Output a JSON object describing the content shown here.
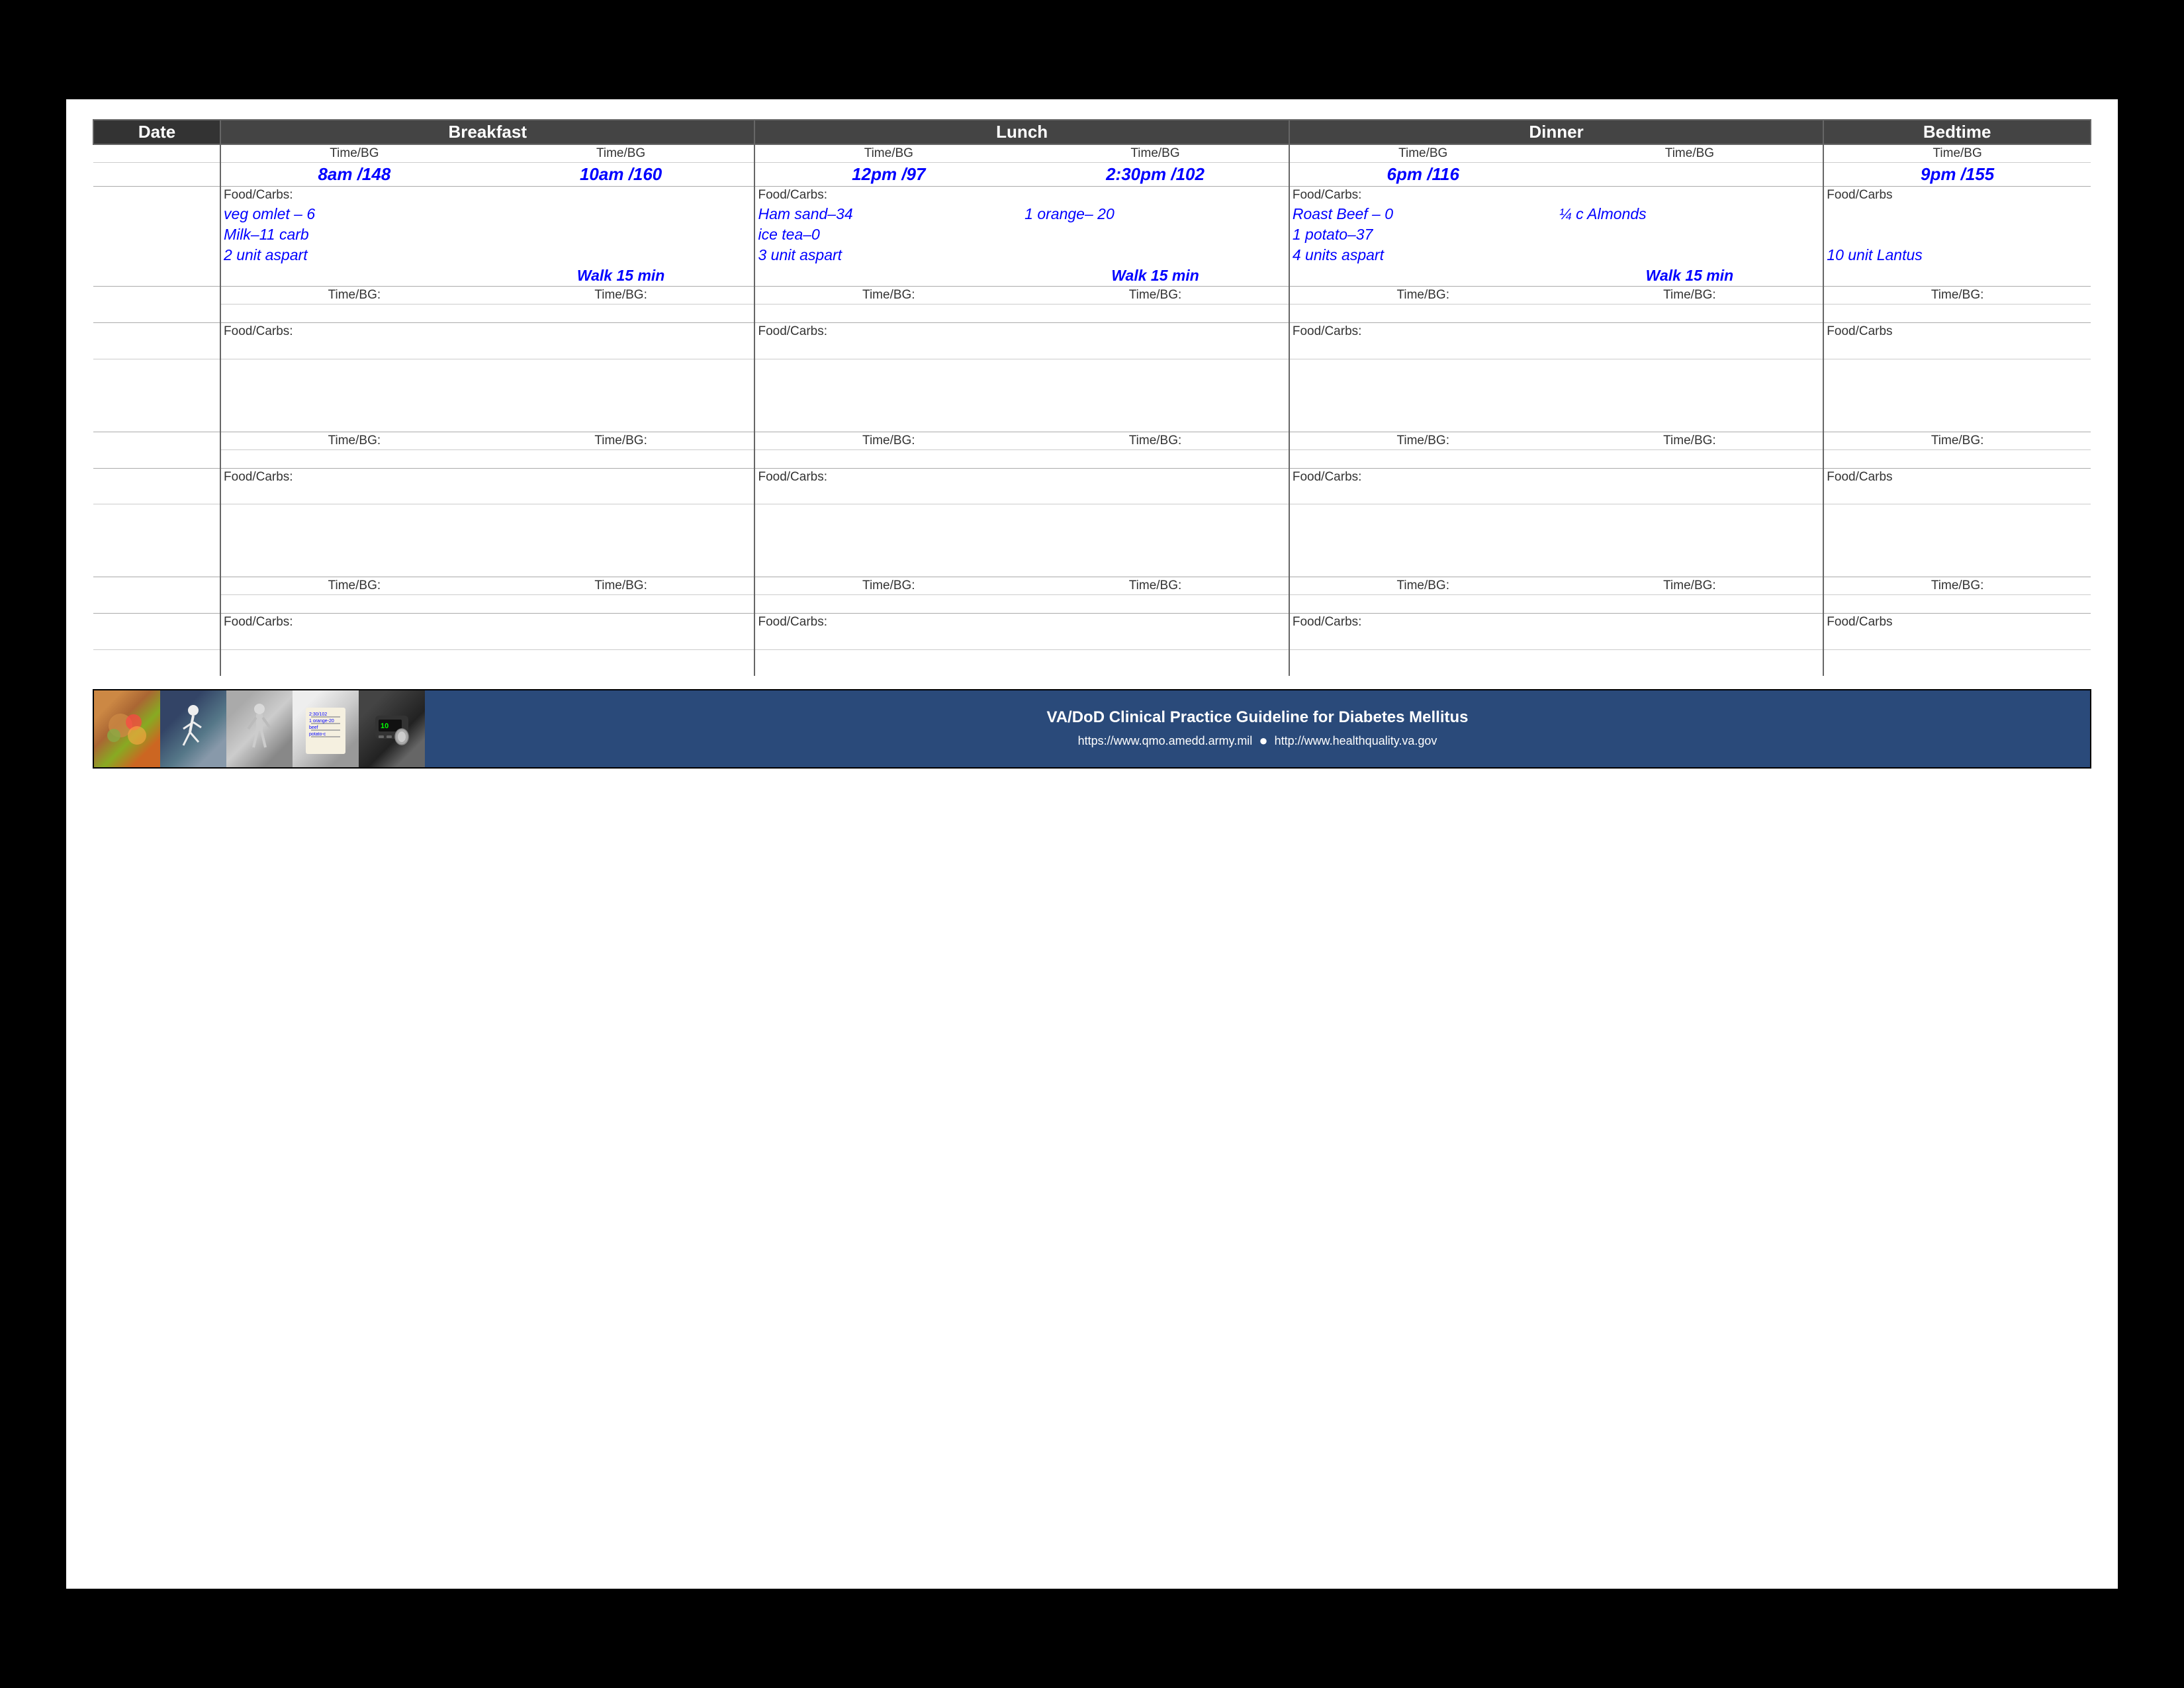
{
  "header": {
    "date_col": "Date",
    "breakfast_col": "Breakfast",
    "lunch_col": "Lunch",
    "dinner_col": "Dinner",
    "bedtime_col": "Bedtime"
  },
  "subheader": {
    "timebg": "Time/BG"
  },
  "row1": {
    "b1_time": "8am /148",
    "b2_time": "10am /160",
    "l1_time": "12pm /97",
    "l2_time": "2:30pm /102",
    "d1_time": "6pm /116",
    "d2_time": "",
    "bt_time": "9pm /155"
  },
  "row1_food": {
    "b1_label": "Food/Carbs:",
    "b2_label": "",
    "l1_label": "Food/Carbs:",
    "l2_label": "",
    "d1_label": "Food/Carbs:",
    "d2_label": "",
    "bt_label": "Food/Carbs"
  },
  "row1_foodval": {
    "b1_val": "veg omlet – 6",
    "l1_val": "Ham sand–34",
    "l2_val": "1 orange– 20",
    "d1_val": "Roast Beef – 0",
    "d2_val": "¼ c Almonds"
  },
  "row1_foodval2": {
    "b1_val2": "Milk–11 carb",
    "l1_val2": "ice tea–0",
    "d1_val2": "1 potato–37"
  },
  "row1_insulin": {
    "b1_val": "2 unit aspart",
    "l1_val": "3 unit aspart",
    "d1_val": "4 units aspart",
    "bt_val": "10 unit Lantus"
  },
  "row1_walk": {
    "b2": "Walk 15 min",
    "l2": "Walk 15 min",
    "d2": "Walk 15 min"
  },
  "empty_rows": {
    "timebg": "Time/BG:",
    "food_carbs": "Food/Carbs:",
    "food_carbs_bt": "Food/Carbs"
  },
  "footer": {
    "title": "VA/DoD Clinical Practice Guideline for Diabetes Mellitus",
    "url1": "https://www.qmo.amedd.army.mil",
    "url2": "http://www.healthquality.va.gov",
    "dot": "●"
  }
}
